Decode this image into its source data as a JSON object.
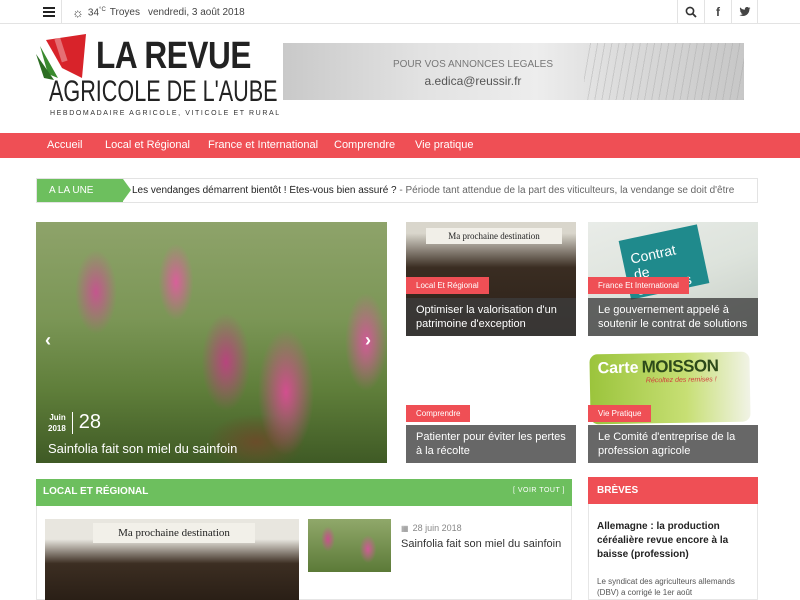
{
  "topbar": {
    "weather_temp": "34",
    "weather_unit": "°C",
    "weather_city": "Troyes",
    "date": "vendredi, 3 août 2018"
  },
  "logo": {
    "title_line1": "LA REVUE",
    "title_line2": "AGRICOLE DE L'AUBE",
    "subtitle": "HEBDOMADAIRE AGRICOLE, VITICOLE ET RURAL"
  },
  "ad": {
    "line1": "POUR VOS ANNONCES LEGALES",
    "line2": "a.edica@reussir.fr"
  },
  "nav": {
    "items": [
      "Accueil",
      "Local et Régional",
      "France et International",
      "Comprendre",
      "Vie pratique"
    ]
  },
  "alaune": {
    "tag": "A LA UNE",
    "headline": "Les vendanges démarrent bientôt ! Êtes-vous bien assuré ?",
    "excerpt": " - Période tant attendue de la part des viticulteurs, la vendange se doit d'être"
  },
  "hero": {
    "month": "Juin",
    "year": "2018",
    "day": "28",
    "title": "Sainfolia fait son miel du sainfoin"
  },
  "tiles": [
    {
      "tag": "Local Et Régional",
      "title": "Optimiser la valorisation d'un patrimoine d'exception",
      "image_text": "Ma prochaine destination"
    },
    {
      "tag": "France Et International",
      "title": "Le gouvernement appelé à soutenir le contrat de solutions",
      "image_text": "Contrat de solutions"
    },
    {
      "tag": "Comprendre",
      "title": "Patienter pour éviter les pertes à la récolte"
    },
    {
      "tag": "Vie Pratique",
      "title": "Le Comité d'entreprise de la profession agricole",
      "image_text_1": "Carte",
      "image_text_2": "MOISSON",
      "image_text_3": "Récoltez des remises !"
    }
  ],
  "local_section": {
    "title": "LOCAL ET RÉGIONAL",
    "more": "[ VOIR TOUT ]",
    "big_image_text": "Ma prochaine destination",
    "item_date": "28 juin 2018",
    "item_title": "Sainfolia fait son miel du sainfoin"
  },
  "breves": {
    "title": "BRÈVES",
    "item_title": "Allemagne : la production céréalière revue encore à la baisse (profession)",
    "item_text": "Le syndicat des agriculteurs allemands (DBV) a corrigé le 1er août"
  },
  "colors": {
    "red": "#ef4f55",
    "green": "#6dbf5e"
  }
}
